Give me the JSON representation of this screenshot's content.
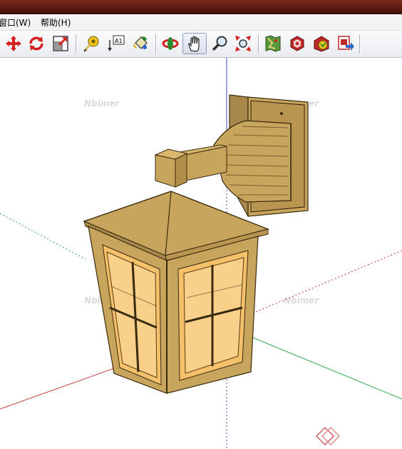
{
  "menu": {
    "window_label": "窗口(W)",
    "help_label": "帮助(H)"
  },
  "toolbar": {
    "tools": [
      {
        "name": "move-icon"
      },
      {
        "name": "rotate-icon"
      },
      {
        "name": "scale-icon"
      },
      {
        "name": "tape-measure-icon"
      },
      {
        "name": "text-icon",
        "label": "A1"
      },
      {
        "name": "paint-bucket-icon"
      },
      {
        "name": "orbit-icon"
      },
      {
        "name": "pan-icon",
        "selected": true
      },
      {
        "name": "zoom-icon"
      },
      {
        "name": "zoom-extents-icon"
      },
      {
        "name": "map-icon"
      },
      {
        "name": "components-icon"
      },
      {
        "name": "warehouse-icon"
      },
      {
        "name": "share-icon"
      }
    ]
  },
  "viewport": {
    "watermark": "Nbimer",
    "model": "wall-lantern",
    "axis_colors": {
      "red": "#c43a3a",
      "green": "#2fa84f",
      "blue": "#3f4fbf"
    },
    "lantern_color": "#c8a55c",
    "glass_color": "#f4c06a"
  }
}
